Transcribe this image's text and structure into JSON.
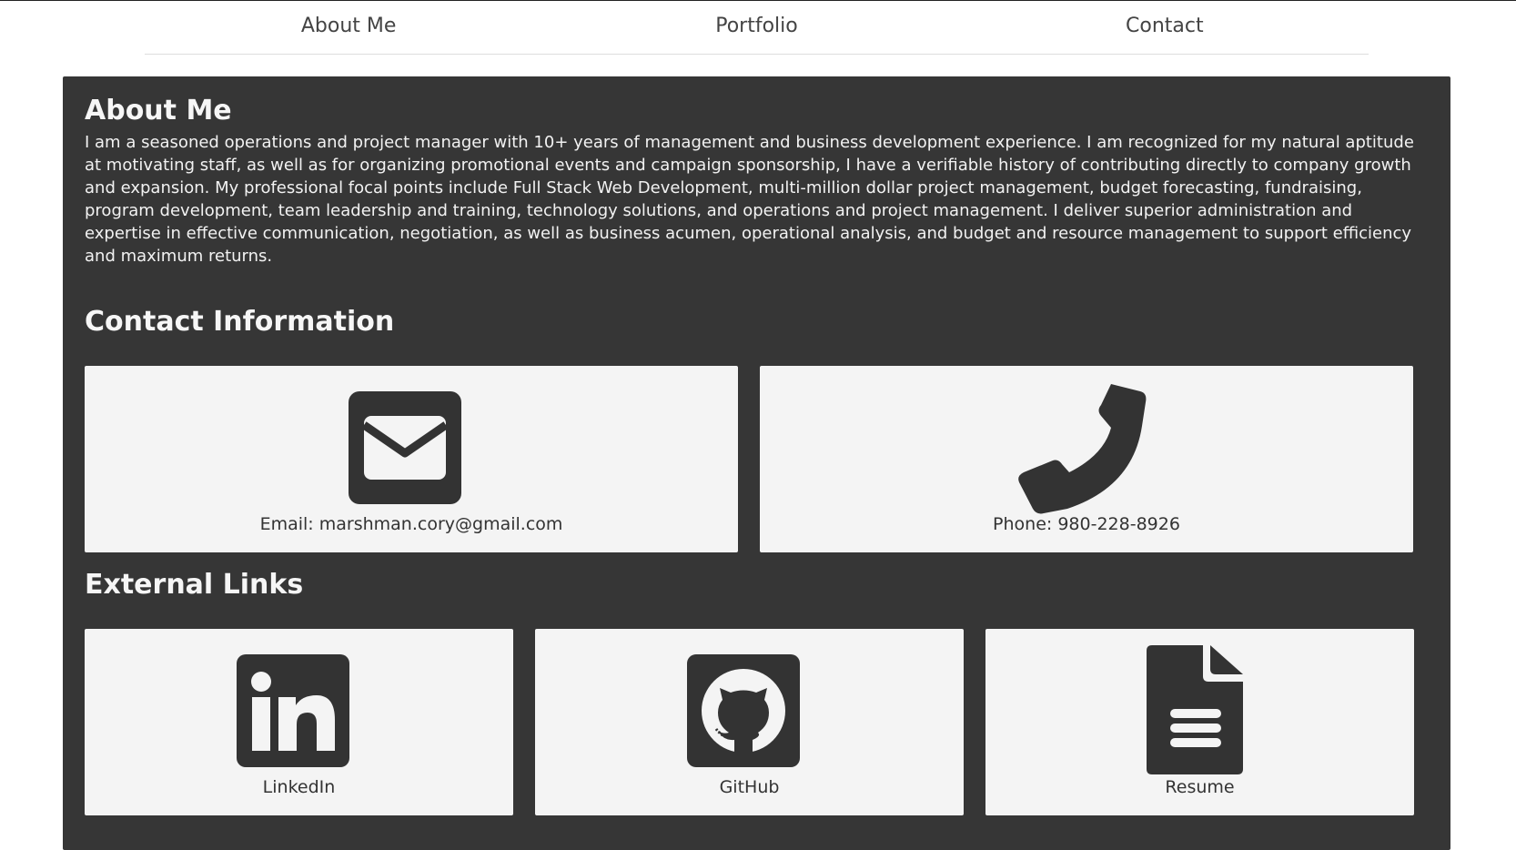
{
  "nav": {
    "items": [
      {
        "label": "About Me"
      },
      {
        "label": "Portfolio"
      },
      {
        "label": "Contact"
      }
    ]
  },
  "about": {
    "title": "About Me",
    "text": "I am a seasoned operations and project manager with 10+ years of management and business development experience. I am recognized for my natural aptitude at motivating staff, as well as for organizing promotional events and campaign sponsorship, I have a verifiable history of contributing directly to company growth and expansion. My professional focal points include Full Stack Web Development, multi-million dollar project management, budget forecasting, fundraising, program development, team leadership and training, technology solutions, and operations and project management. I deliver superior administration and expertise in effective communication, negotiation, as well as business acumen, operational analysis, and budget and resource management to support efficiency and maximum returns."
  },
  "contact": {
    "title": "Contact Information",
    "email_label": "Email: marshman.cory@gmail.com",
    "phone_label": "Phone: 980-228-8926",
    "email_icon": "envelope-square-icon",
    "phone_icon": "phone-icon"
  },
  "links": {
    "title": "External Links",
    "items": [
      {
        "label": "LinkedIn",
        "icon": "linkedin-icon"
      },
      {
        "label": "GitHub",
        "icon": "github-icon"
      },
      {
        "label": "Resume",
        "icon": "file-document-icon"
      }
    ]
  },
  "colors": {
    "panel_bg": "#363636",
    "card_bg": "#f4f4f4",
    "icon": "#333333",
    "nav_text": "#444444"
  }
}
